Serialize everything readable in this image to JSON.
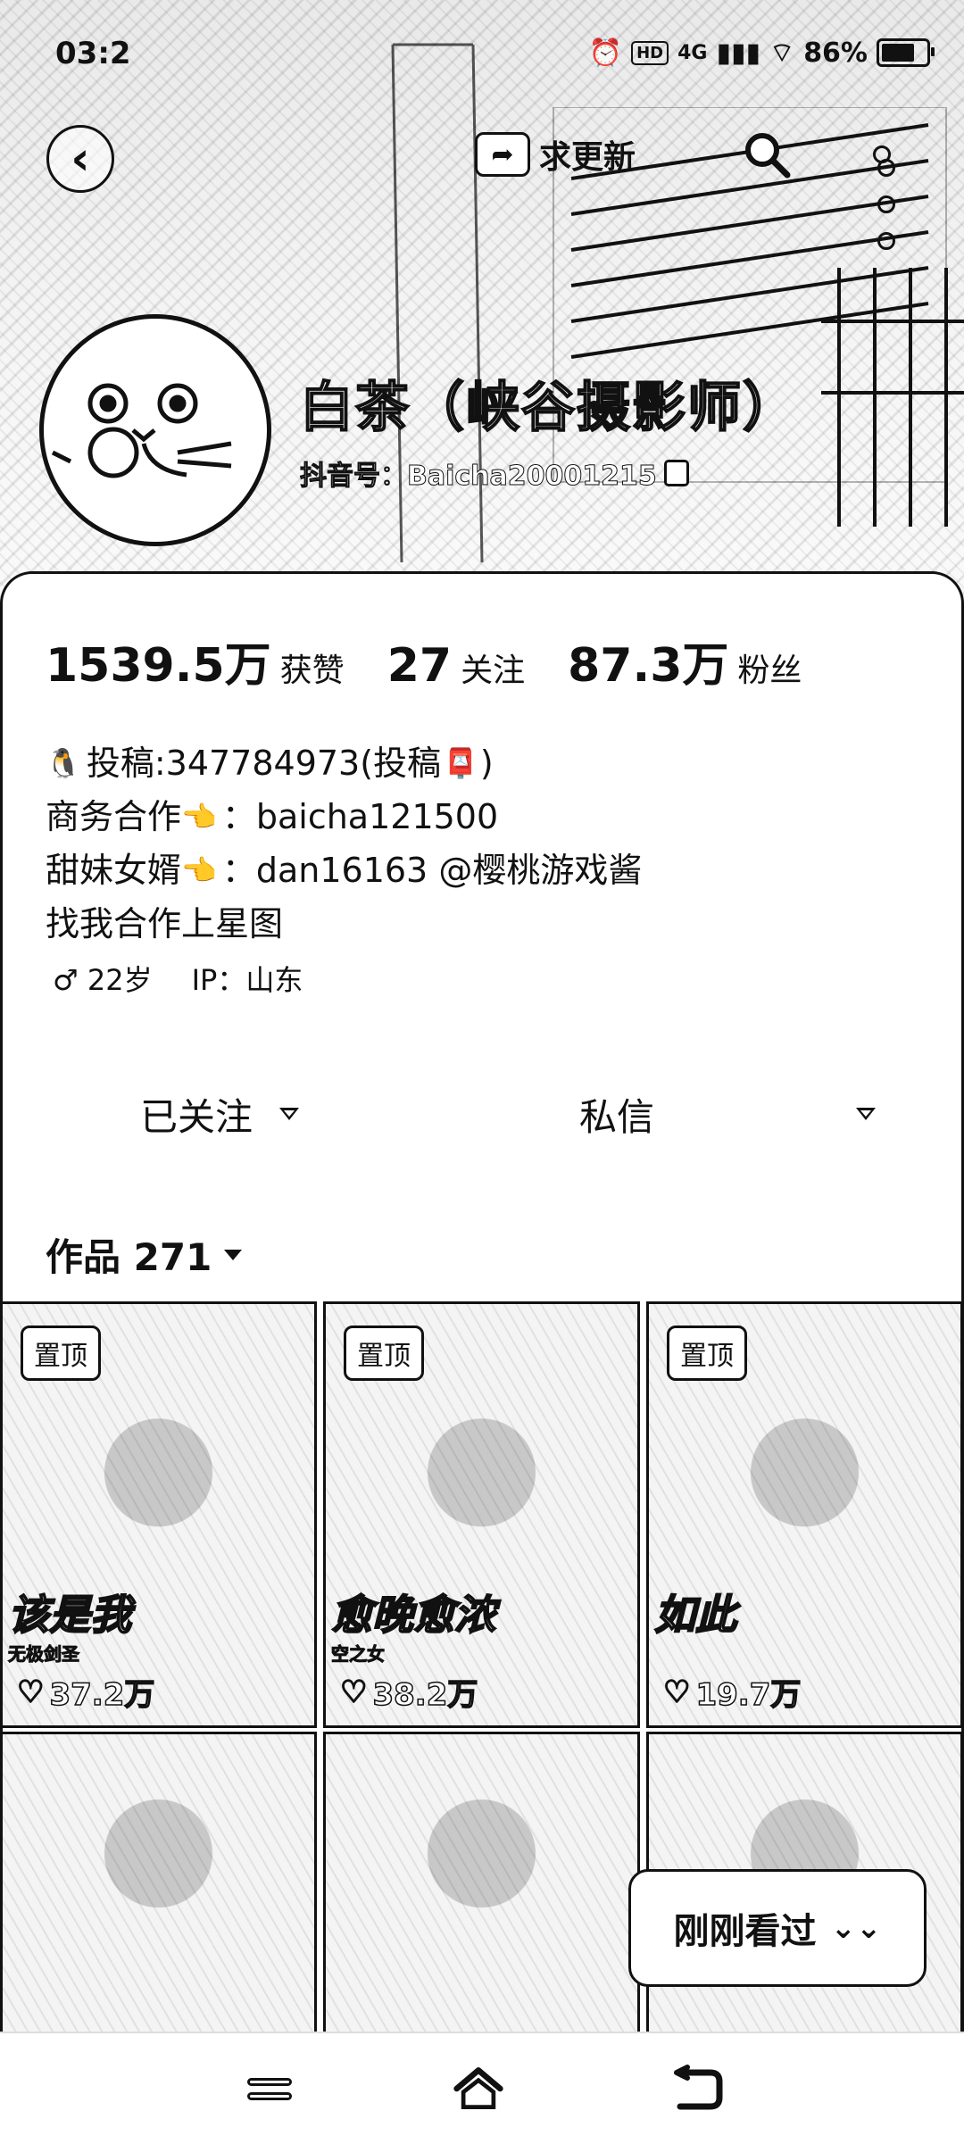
{
  "status_bar": {
    "time": "03:2",
    "hd": "HD",
    "network": "4G",
    "battery": "86%",
    "battery_level": 0.86
  },
  "top_bar": {
    "back_icon": "chevron-left-icon",
    "update_label": "求更新",
    "search_icon": "search-icon",
    "more_icon": "more-dots-icon"
  },
  "profile": {
    "name": "白茶（峡谷摄影师）",
    "douyin_id": "抖音号：Baicha20001215"
  },
  "stats": [
    {
      "num": "1539.5万",
      "label": "获赞"
    },
    {
      "num": "27",
      "label": "关注"
    },
    {
      "num": "87.3万",
      "label": "粉丝"
    }
  ],
  "bio": {
    "line1": "投稿:347784973(投稿",
    "line1_end": ")",
    "line2": "商务合作",
    "line2_value": "：baicha121500",
    "line3": "甜妹女婿",
    "line3_value": "：dan16163 @樱桃游戏酱",
    "line4": "找我合作上星图"
  },
  "tags": {
    "gender_age": "♂ 22岁",
    "ip": "IP：山东"
  },
  "actions": {
    "follow": "已关注",
    "message": "私信"
  },
  "works": {
    "tab_label": "作品 271",
    "pin_label": "置顶",
    "items": [
      {
        "overlay": "该是我",
        "sub": "无极剑圣",
        "likes": "37.2万"
      },
      {
        "overlay": "愈晚愈浓",
        "sub": "空之女",
        "likes": "38.2万"
      },
      {
        "overlay": "如此",
        "sub": "",
        "likes": "19.7万"
      }
    ]
  },
  "recent_button": "刚刚看过"
}
